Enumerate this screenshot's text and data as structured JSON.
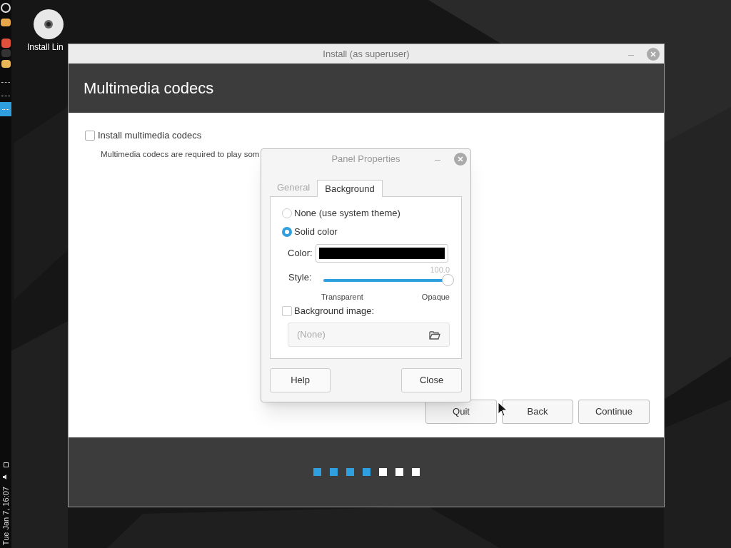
{
  "panel": {
    "clock": "Tue Jan 7, 16:07"
  },
  "desktop_icons": [
    {
      "label": "Install Lin"
    }
  ],
  "installer": {
    "title": "Install (as superuser)",
    "heading": "Multimedia codecs",
    "option": {
      "label": "Install multimedia codecs",
      "checked": false
    },
    "description": "Multimedia codecs are required to play som",
    "buttons": [
      "Quit",
      "Back",
      "Continue"
    ],
    "steps": [
      {
        "done": true
      },
      {
        "done": true
      },
      {
        "done": true
      },
      {
        "done": true
      },
      {
        "done": false
      },
      {
        "done": false
      },
      {
        "done": false
      }
    ]
  },
  "dialog": {
    "title": "Panel Properties",
    "tabs": [
      {
        "label": "General",
        "selected": false
      },
      {
        "label": "Background",
        "selected": true
      }
    ],
    "radios": [
      {
        "label": "None (use system theme)",
        "selected": false
      },
      {
        "label": "Solid color",
        "selected": true
      }
    ],
    "color": {
      "label": "Color:",
      "color": "#000000"
    },
    "style": {
      "label": "Style:",
      "reading": "100.0",
      "level": 1.0,
      "min_label": "Transparent",
      "max_label": "Opaque"
    },
    "image_option": {
      "label": "Background image:",
      "checked": false
    },
    "file": {
      "value": "(None)",
      "disabled": true
    },
    "buttons": [
      "Help",
      "Close"
    ]
  }
}
